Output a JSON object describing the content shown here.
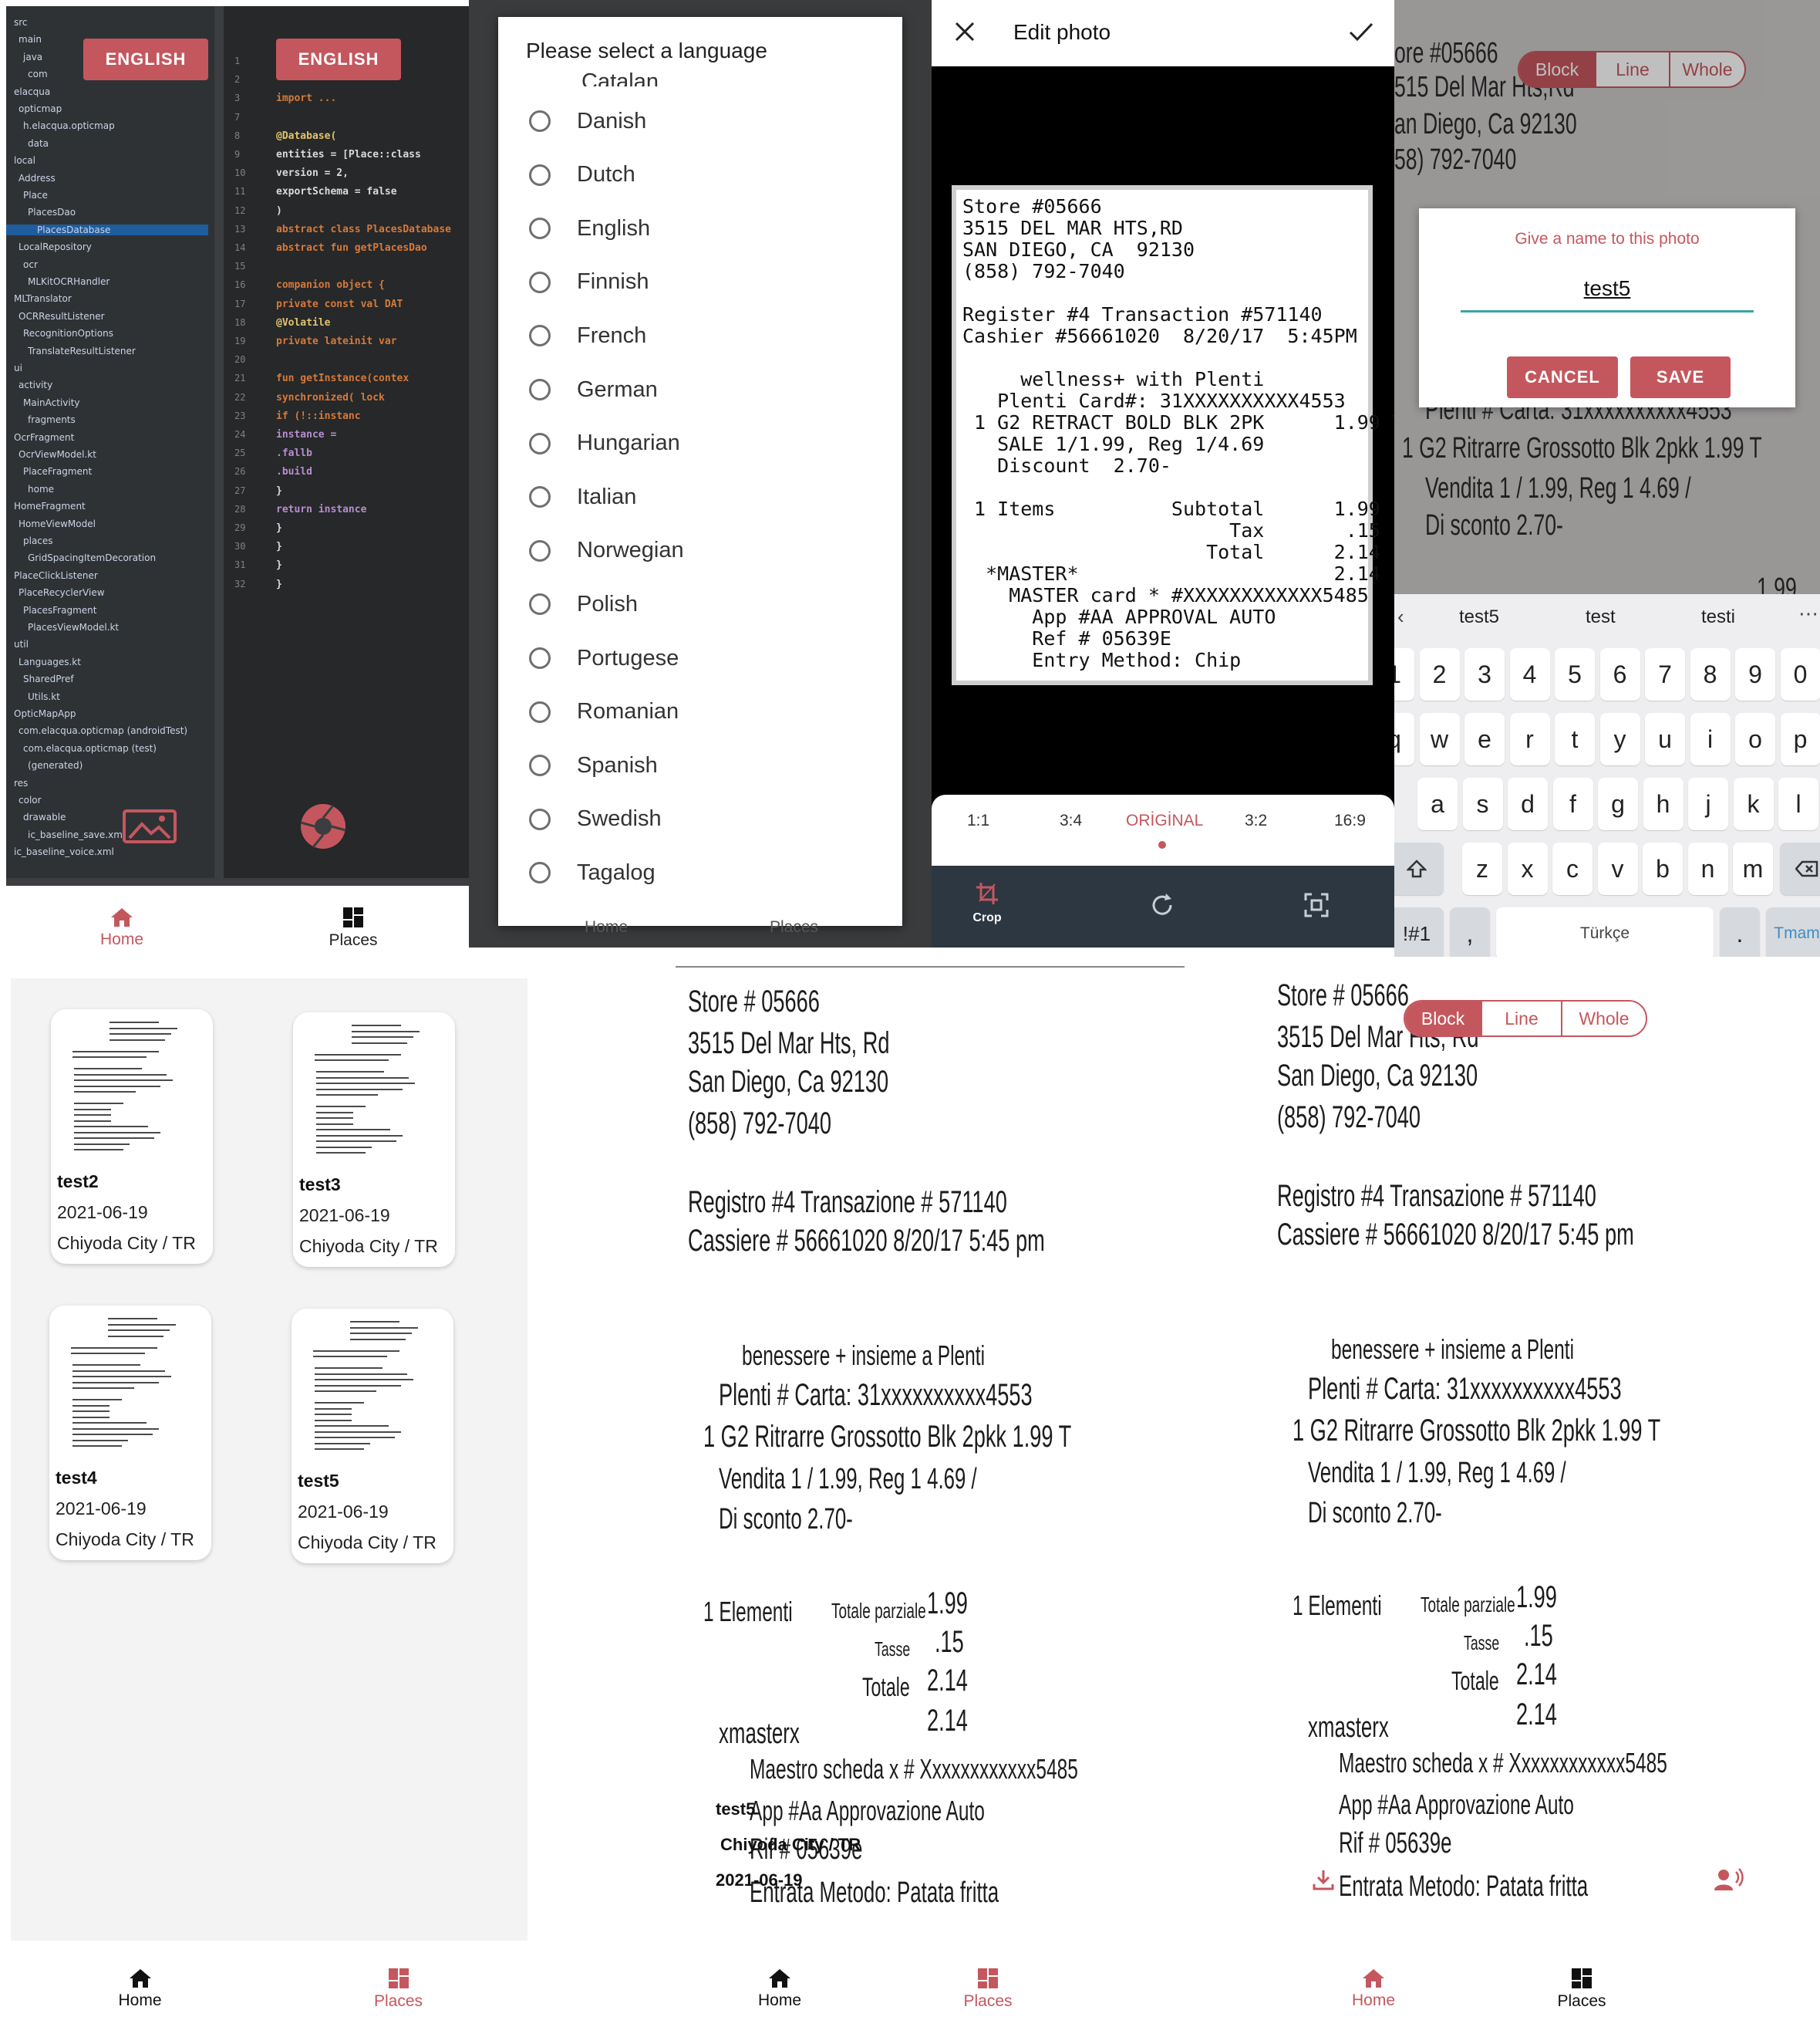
{
  "nav": {
    "home": "Home",
    "places": "Places"
  },
  "accent": "#c4575e",
  "panel1": {
    "english_button": "ENGLISH",
    "tree_items": [
      "src",
      "main",
      "java",
      "com",
      "elacqua",
      "opticmap",
      "h.elacqua.opticmap",
      "data",
      "local",
      "Address",
      "Place",
      "PlacesDao",
      "PlacesDatabase",
      "LocalRepository",
      "ocr",
      "MLKitOCRHandler",
      "MLTranslator",
      "OCRResultListener",
      "RecognitionOptions",
      "TranslateResultListener",
      "ui",
      "activity",
      "MainActivity",
      "fragments",
      "OcrFragment",
      "OcrViewModel.kt",
      "PlaceFragment",
      "home",
      "HomeFragment",
      "HomeViewModel",
      "places",
      "GridSpacingItemDecoration",
      "PlaceClickListener",
      "PlaceRecyclerView",
      "PlacesFragment",
      "PlacesViewModel.kt",
      "util",
      "Languages.kt",
      "SharedPref",
      "Utils.kt",
      "OpticMapApp",
      "com.elacqua.opticmap (androidTest)",
      "com.elacqua.opticmap (test)",
      "(generated)",
      "res",
      "color",
      "drawable",
      "ic_baseline_save.xml",
      "ic_baseline_voice.xml"
    ],
    "code_lines": [
      {
        "n": "1",
        "t": ""
      },
      {
        "n": "2",
        "t": ""
      },
      {
        "n": "3",
        "t": "import ..."
      },
      {
        "n": "7",
        "t": ""
      },
      {
        "n": "8",
        "t": "@Database("
      },
      {
        "n": "9",
        "t": "    entities = [Place::class"
      },
      {
        "n": "10",
        "t": "    version = 2,"
      },
      {
        "n": "11",
        "t": "    exportSchema = false"
      },
      {
        "n": "12",
        "t": ")"
      },
      {
        "n": "13",
        "t": "abstract class PlacesDatabase"
      },
      {
        "n": "14",
        "t": "    abstract fun getPlacesDao"
      },
      {
        "n": "15",
        "t": ""
      },
      {
        "n": "16",
        "t": "    companion object {"
      },
      {
        "n": "17",
        "t": "        private const val DAT"
      },
      {
        "n": "18",
        "t": "        @Volatile"
      },
      {
        "n": "19",
        "t": "        private lateinit var"
      },
      {
        "n": "20",
        "t": ""
      },
      {
        "n": "21",
        "t": "        fun getInstance(contex"
      },
      {
        "n": "22",
        "t": "            synchronized( lock"
      },
      {
        "n": "23",
        "t": "                if (!::instanc"
      },
      {
        "n": "24",
        "t": "                    instance ="
      },
      {
        "n": "25",
        "t": "                        .fallb"
      },
      {
        "n": "26",
        "t": "                        .build"
      },
      {
        "n": "27",
        "t": "                }"
      },
      {
        "n": "28",
        "t": "                return instance"
      },
      {
        "n": "29",
        "t": "            }"
      },
      {
        "n": "30",
        "t": "        }"
      },
      {
        "n": "31",
        "t": "    }"
      },
      {
        "n": "32",
        "t": "}"
      }
    ]
  },
  "panel2": {
    "title": "Please select a language",
    "partial_top": "Catalan",
    "languages": [
      "Danish",
      "Dutch",
      "English",
      "Finnish",
      "French",
      "German",
      "Hungarian",
      "Italian",
      "Norwegian",
      "Polish",
      "Portugese",
      "Romanian",
      "Spanish",
      "Swedish",
      "Tagalog"
    ]
  },
  "panel3": {
    "title": "Edit photo",
    "receipt_text": "Store #05666\n3515 DEL MAR HTS,RD\nSAN DIEGO, CA  92130\n(858) 792-7040\n\nRegister #4 Transaction #571140\nCashier #56661020  8/20/17  5:45PM\n\n     wellness+ with Plenti\n   Plenti Card#: 31XXXXXXXXXX4553\n 1 G2 RETRACT BOLD BLK 2PK      1.99 T\n   SALE 1/1.99, Reg 1/4.69\n   Discount  2.70-\n\n 1 Items          Subtotal      1.99\n                       Tax       .15\n                     Total      2.14\n  *MASTER*                      2.14\n    MASTER card * #XXXXXXXXXXXX5485\n      App #AA APPROVAL AUTO\n      Ref # 05639E\n      Entry Method: Chip",
    "ratios": [
      "1:1",
      "3:4",
      "ORİGİNAL",
      "3:2",
      "16:9"
    ],
    "tool_crop": "Crop"
  },
  "panel4": {
    "segments": [
      "Block",
      "Line",
      "Whole"
    ],
    "photo_lines": [
      "ore  #05666",
      "515 Del Mar Hts,Rd",
      "an Diego,   Ca   92130",
      "58)  792-7040",
      "Plenti  # Carta: 31xxxxxxxxxx4553",
      "1 G2 Ritrarre  Grossotto  Blk  2pkk   1.99 T",
      "Vendita 1 / 1.99, Reg 1 4.69 /",
      "Di sconto  2.70-",
      "1.99"
    ],
    "dialog_prompt": "Give a name to this photo",
    "dialog_value": "test5",
    "cancel": "CANCEL",
    "save": "SAVE",
    "suggestions": [
      "test5",
      "test",
      "testi"
    ],
    "keyboard_rows": [
      [
        "1",
        "2",
        "3",
        "4",
        "5",
        "6",
        "7",
        "8",
        "9",
        "0"
      ],
      [
        "q",
        "w",
        "e",
        "r",
        "t",
        "y",
        "u",
        "i",
        "o",
        "p"
      ],
      [
        "a",
        "s",
        "d",
        "f",
        "g",
        "h",
        "j",
        "k",
        "l"
      ],
      [
        "z",
        "x",
        "c",
        "v",
        "b",
        "n",
        "m"
      ]
    ],
    "sym_key": "!#1",
    "comma": ",",
    "space_label": "Türkçe",
    "period": ".",
    "enter_label": "Tmam"
  },
  "panel5": {
    "cards": [
      {
        "name": "test2",
        "date": "2021-06-19",
        "city": "Chiyoda City / TR"
      },
      {
        "name": "test3",
        "date": "2021-06-19",
        "city": "Chiyoda City / TR"
      },
      {
        "name": "test4",
        "date": "2021-06-19",
        "city": "Chiyoda City / TR"
      },
      {
        "name": "test5",
        "date": "2021-06-19",
        "city": "Chiyoda City / TR"
      }
    ]
  },
  "ocr": {
    "lines": [
      "Store  # 05666",
      "3515  Del  Mar  Hts, Rd",
      "San  Diego,     Ca    92130",
      "(858)   792-7040",
      "Registro  #4  Transazione  # 571140",
      "Cassiere # 56661020   8/20/17    5:45 pm",
      "benessere +  insieme a   Plenti",
      "Plenti  # Carta:  31xxxxxxxxxx4553",
      "1  G2  Ritrarre  Grossotto  Blk  2pkk        1.99  T",
      "Vendita  1 / 1.99,  Reg  1 4.69 /",
      "Di sconto   2.70-",
      "1  Elementi",
      "Totale parziale",
      "1.99",
      "Tasse",
      ".15",
      "Totale",
      "2.14",
      "xmasterx",
      "2.14",
      "Maestro  scheda  x  # Xxxxxxxxxxxx5485",
      "App  #Aa  Approvazione  Auto",
      "Rif  #  05639e",
      "Entrata  Metodo:  Patata fritta"
    ],
    "detail": {
      "name": "test5",
      "city": "Chiyoda City / TR",
      "date": "2021-06-19"
    },
    "segments": [
      "Block",
      "Line",
      "Whole"
    ]
  }
}
